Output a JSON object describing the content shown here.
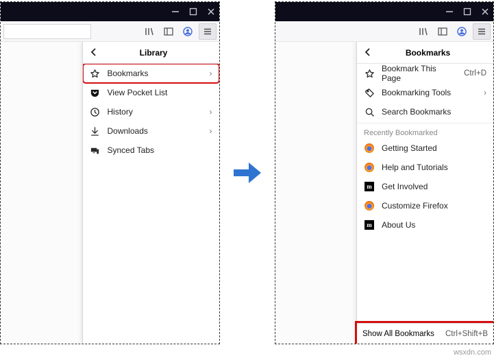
{
  "watermark": "wsxdn.com",
  "left": {
    "panel_title": "Library",
    "items": [
      {
        "icon": "star-outline",
        "label": "Bookmarks",
        "chev": true,
        "highlight": true
      },
      {
        "icon": "pocket",
        "label": "View Pocket List",
        "chev": false
      },
      {
        "icon": "clock",
        "label": "History",
        "chev": true
      },
      {
        "icon": "download",
        "label": "Downloads",
        "chev": true
      },
      {
        "icon": "synced",
        "label": "Synced Tabs",
        "chev": false
      }
    ]
  },
  "right": {
    "panel_title": "Bookmarks",
    "top_items": [
      {
        "icon": "star-outline",
        "label": "Bookmark This Page",
        "shortcut": "Ctrl+D"
      },
      {
        "icon": "tag",
        "label": "Bookmarking Tools",
        "chev": true
      },
      {
        "icon": "search",
        "label": "Search Bookmarks"
      }
    ],
    "recent_heading": "Recently Bookmarked",
    "recent_items": [
      {
        "favicon": "ff",
        "label": "Getting Started"
      },
      {
        "favicon": "ff",
        "label": "Help and Tutorials"
      },
      {
        "favicon": "m",
        "label": "Get Involved"
      },
      {
        "favicon": "ff",
        "label": "Customize Firefox"
      },
      {
        "favicon": "m",
        "label": "About Us"
      }
    ],
    "footer_label": "Show All Bookmarks",
    "footer_shortcut": "Ctrl+Shift+B"
  }
}
